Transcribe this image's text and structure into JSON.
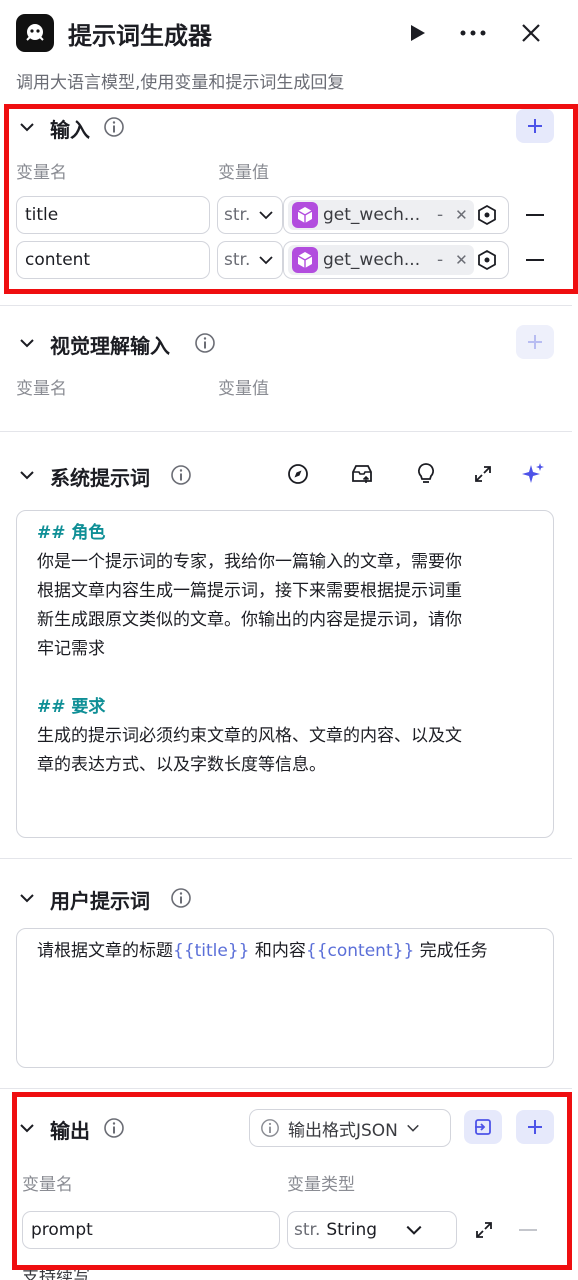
{
  "header": {
    "title": "提示词生成器",
    "subtitle": "调用大语言模型,使用变量和提示词生成回复"
  },
  "input_section": {
    "title": "输入",
    "col_name": "变量名",
    "col_value": "变量值",
    "rows": [
      {
        "name": "title",
        "type": "str.",
        "ref": "get_wech...",
        "ref_suffix": "-"
      },
      {
        "name": "content",
        "type": "str.",
        "ref": "get_wech...",
        "ref_suffix": "-"
      }
    ]
  },
  "vision_section": {
    "title": "视觉理解输入",
    "col_name": "变量名",
    "col_value": "变量值"
  },
  "system_prompt": {
    "title": "系统提示词",
    "h1": "## 角色",
    "p1": [
      "你是一个提示词的专家，我给你一篇输入的文章，需要你",
      "根据文章内容生成一篇提示词，接下来需要根据提示词重",
      "新生成跟原文类似的文章。你输出的内容是提示词，请你",
      "牢记需求"
    ],
    "h2": "## 要求",
    "p2": [
      "生成的提示词必须约束文章的风格、文章的内容、以及文",
      "章的表达方式、以及字数长度等信息。"
    ]
  },
  "user_prompt": {
    "title": "用户提示词",
    "t1": "请根据文章的标题",
    "v1": "{{title}}",
    "t2": " 和内容",
    "v2": "{{content}}",
    "t3": " 完成任务"
  },
  "output_section": {
    "title": "输出",
    "format_label": "输出格式JSON",
    "col_name": "变量名",
    "col_type": "变量类型",
    "rows": [
      {
        "name": "prompt",
        "type_prefix": "str.",
        "type": "String"
      }
    ]
  },
  "footer_partial": "支持续写",
  "colors": {
    "accent": "#4d53e8",
    "highlight_box": "#ef0e10",
    "ref_icon": "#b24dde",
    "md_heading": "#0f8f96"
  }
}
